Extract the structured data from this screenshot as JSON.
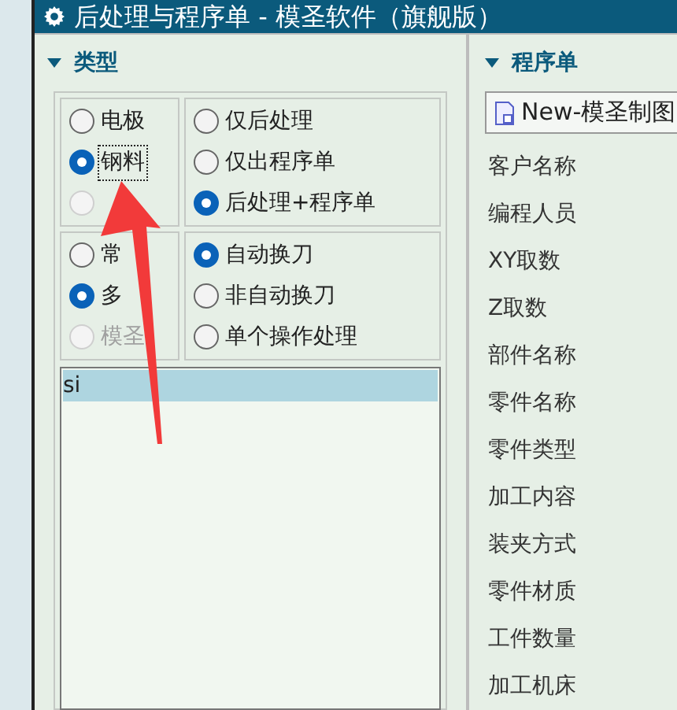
{
  "window": {
    "title": "后处理与程序单 - 模圣软件（旗舰版）"
  },
  "type_panel": {
    "title": "类型",
    "expanded": true,
    "groups": [
      {
        "options": [
          {
            "label": "电极",
            "selected": false,
            "disabled": false
          },
          {
            "label": "钢料",
            "selected": true,
            "disabled": false,
            "focused": true
          },
          {
            "selected": false,
            "disabled": true
          }
        ]
      },
      {
        "options": [
          {
            "label": "仅后处理",
            "selected": false,
            "disabled": false
          },
          {
            "label": "仅出程序单",
            "selected": false,
            "disabled": false
          },
          {
            "label": "后处理+程序单",
            "selected": true,
            "disabled": false
          }
        ]
      },
      {
        "options": [
          {
            "label": "常",
            "selected": false,
            "disabled": false
          },
          {
            "label": "多",
            "selected": true,
            "disabled": false
          },
          {
            "label": "模圣",
            "selected": false,
            "disabled": true
          }
        ]
      },
      {
        "options": [
          {
            "label": "自动换刀",
            "selected": true,
            "disabled": false
          },
          {
            "label": "非自动换刀",
            "selected": false,
            "disabled": false
          },
          {
            "label": "单个操作处理",
            "selected": false,
            "disabled": false
          }
        ]
      }
    ],
    "list": [
      {
        "text": "si",
        "selected": true
      }
    ]
  },
  "program_panel": {
    "title": "程序单",
    "expanded": true,
    "file_button": "New-模圣制图",
    "fields": [
      "客户名称",
      "编程人员",
      "XY取数",
      "Z取数",
      "部件名称",
      "零件名称",
      "零件类型",
      "加工内容",
      "装夹方式",
      "零件材质",
      "工件数量",
      "加工机床"
    ]
  }
}
